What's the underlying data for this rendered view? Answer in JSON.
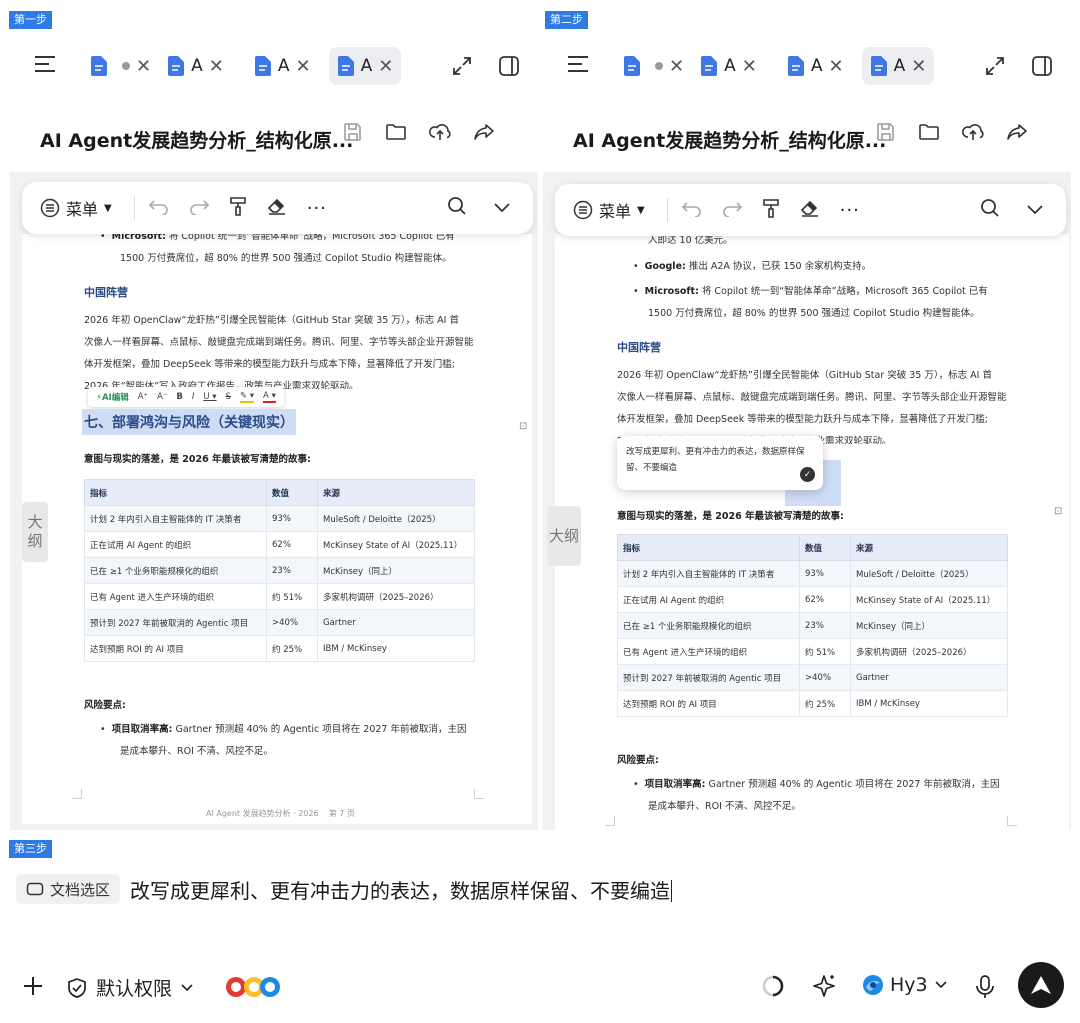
{
  "steps": {
    "step1": "第一步",
    "step2": "第二步",
    "step3": "第三步"
  },
  "doc": {
    "title": "AI Agent发展趋势分析_结构化原...",
    "tab_label": "A",
    "toolbar": {
      "menu_label": "菜单"
    },
    "outline_label": "大纲",
    "bullets_top": {
      "google_b": "Google:",
      "google_t": "推出 A2A 协议，已获 150 余家机构支持。",
      "ms_b": "Microsoft:",
      "ms_t": "将 Copilot 统一到“智能体革命”战略，Microsoft 365 Copilot 已有",
      "ms_t2": "1500 万付费席位，超 80% 的世界 500 强通过 Copilot Studio 构建智能体。",
      "prev_line": "入即达 10 亿美元。"
    },
    "china_heading": "中国阵营",
    "china_para": [
      "2026 年初 OpenClaw“龙虾热”引爆全民智能体（GitHub Star 突破 35 万），标志 AI 首",
      "次像人一样看屏幕、点鼠标、敲键盘完成端到端任务。腾讯、阿里、字节等头部企业开源智能",
      "体开发框架，叠加 DeepSeek 等带来的模型能力跃升与成本下降，显著降低了开发门槛;",
      "2026 年“智能体”写入政府工作报告，政策与产业需求双轮驱动。"
    ],
    "section7": "七、部署鸿沟与风险（关键现实）",
    "section7_partial": "）",
    "intro": "意图与现实的落差，是 2026 年最该被写清楚的故事:",
    "table": {
      "headers": [
        "指标",
        "数值",
        "来源"
      ],
      "rows": [
        [
          "计划 2 年内引入自主智能体的 IT 决策者",
          "93%",
          "MuleSoft / Deloitte（2025）"
        ],
        [
          "正在试用 AI Agent 的组织",
          "62%",
          "McKinsey State of AI（2025.11）"
        ],
        [
          "已在 ≥1 个业务职能规模化的组织",
          "23%",
          "McKinsey（同上）"
        ],
        [
          "已有 Agent 进入生产环境的组织",
          "约 51%",
          "多家机构调研（2025–2026）"
        ],
        [
          "预计到 2027 年前被取消的 Agentic 项目",
          ">40%",
          "Gartner"
        ],
        [
          "达到预期 ROI 的 AI 项目",
          "约 25%",
          "IBM / McKinsey"
        ]
      ]
    },
    "risk_heading": "风险要点:",
    "risk_b": "项目取消率高:",
    "risk_t": "Gartner 预测超 40% 的 Agentic 项目将在 2027 年前被取消，主因",
    "risk_t2": "是成本攀升、ROI 不清、风控不足。",
    "footer": "AI Agent 发展趋势分析 · 2026",
    "page_num": "第 7 页",
    "float_bar": {
      "ai_edit": "AI编辑"
    },
    "popover_text": "改写成更犀利、更有冲击力的表达，数据原样保留、不要编造"
  },
  "chat": {
    "chip_label": "文档选区",
    "input_text": "改写成更犀利、更有冲击力的表达，数据原样保留、不要编造",
    "permission_label": "默认权限",
    "model_label": "Hy3"
  }
}
